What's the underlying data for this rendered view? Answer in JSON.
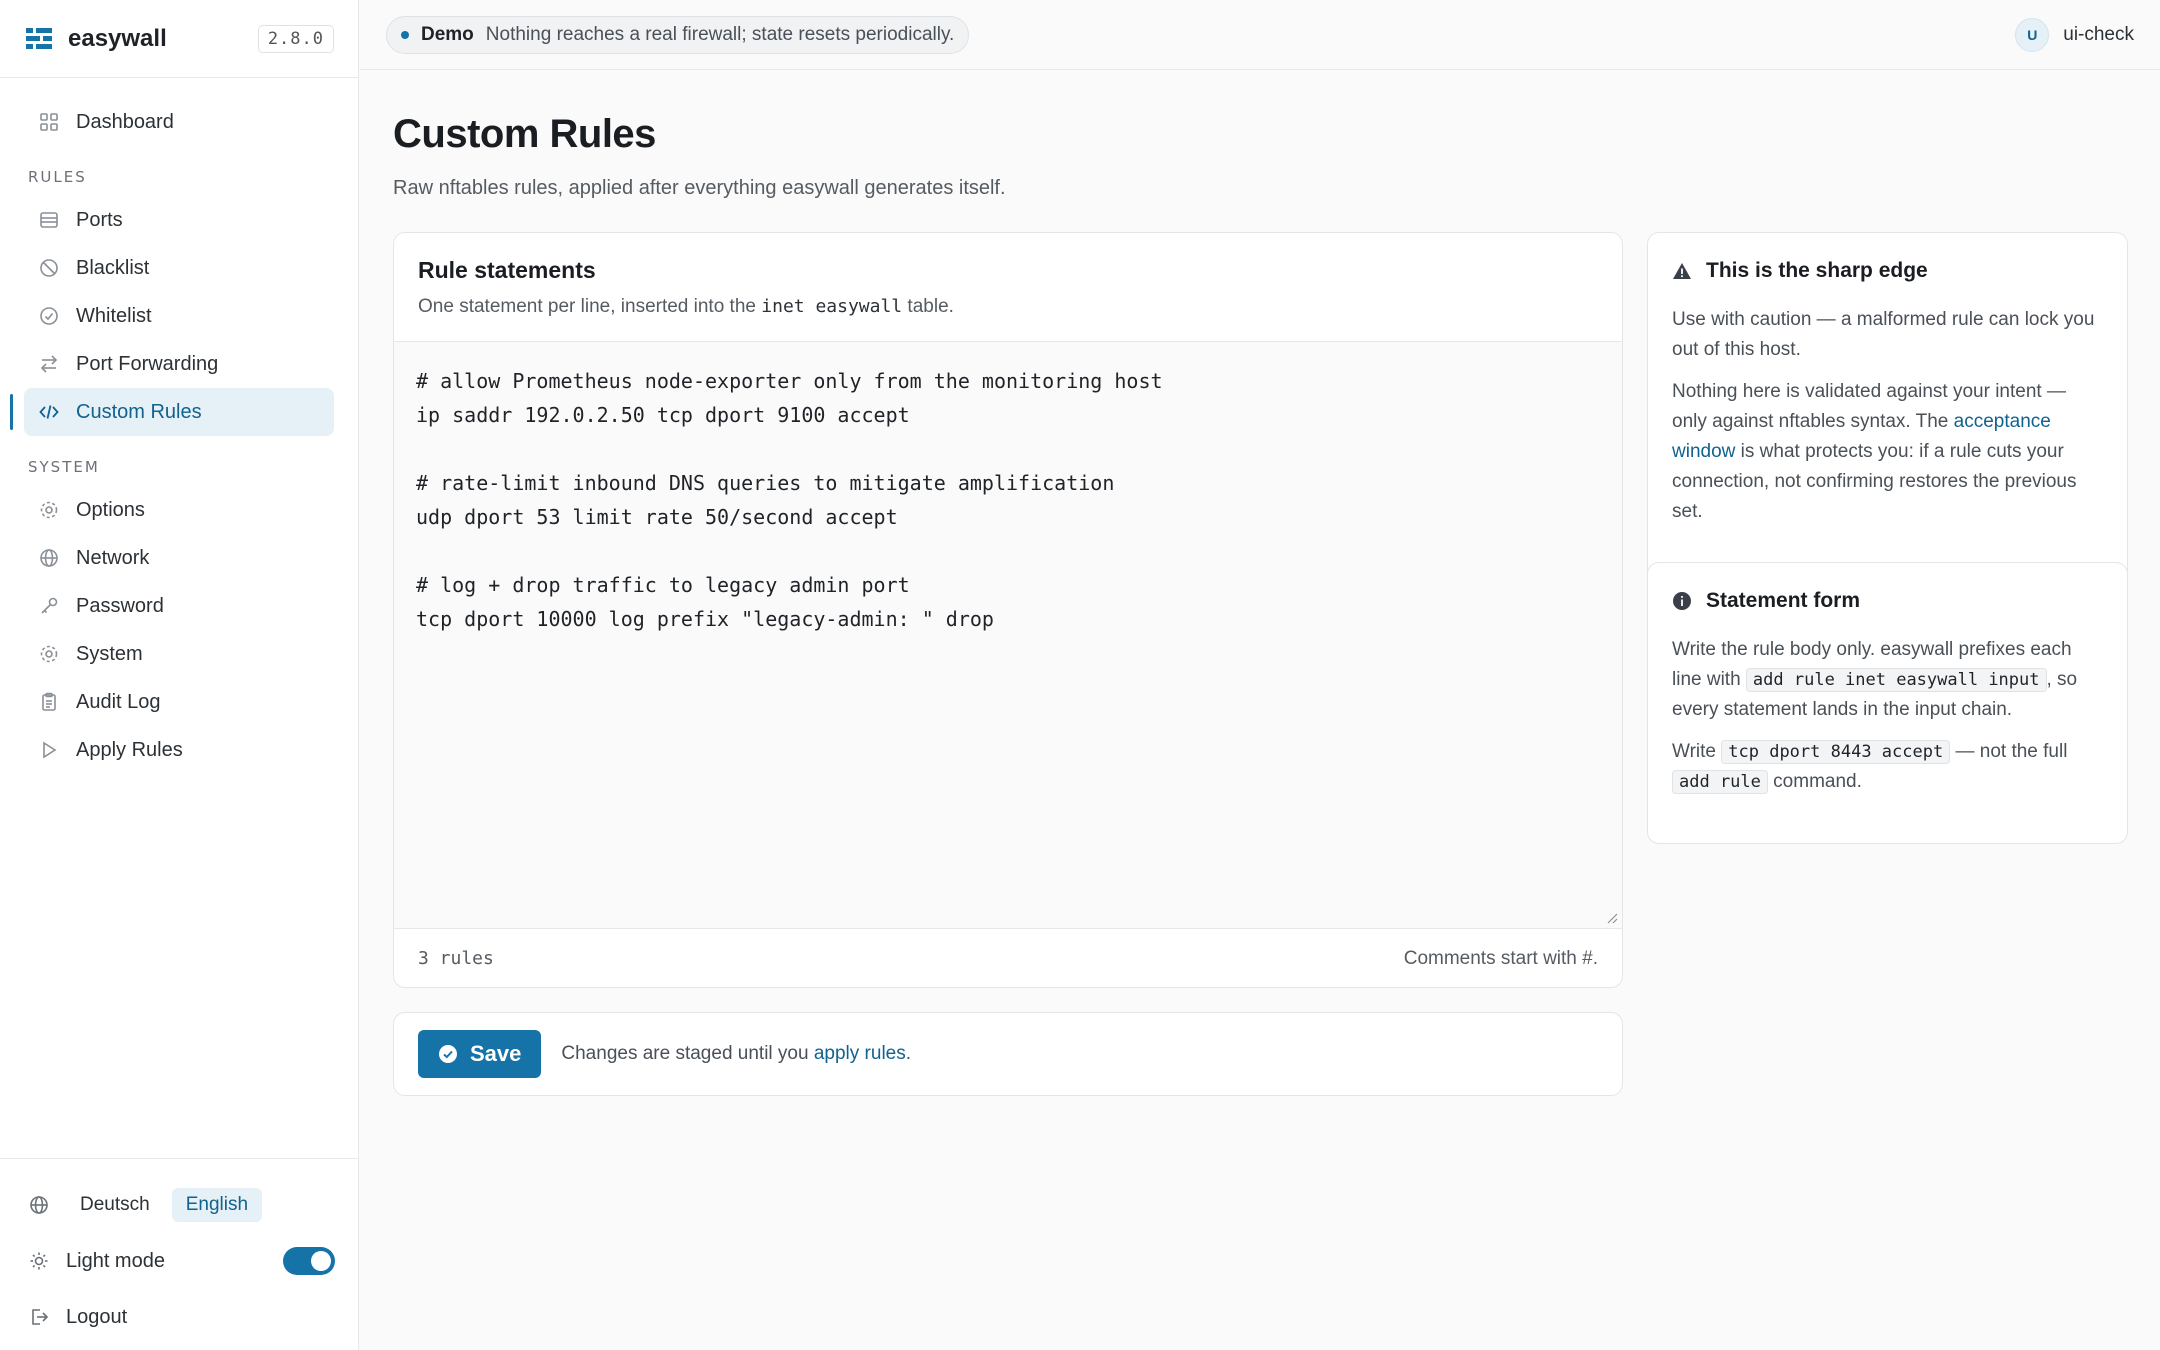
{
  "brand": {
    "name": "easywall",
    "version": "2.8.0"
  },
  "nav": {
    "dashboard": "Dashboard",
    "rules_label": "RULES",
    "rules": [
      "Ports",
      "Blacklist",
      "Whitelist",
      "Port Forwarding",
      "Custom Rules"
    ],
    "system_label": "SYSTEM",
    "system": [
      "Options",
      "Network",
      "Password",
      "System",
      "Audit Log",
      "Apply Rules"
    ],
    "active": "Custom Rules"
  },
  "bottom": {
    "lang_de": "Deutsch",
    "lang_en": "English",
    "mode_label": "Light mode",
    "logout": "Logout"
  },
  "topbar": {
    "demo_title": "Demo",
    "demo_text": "Nothing reaches a real firewall; state resets periodically.",
    "avatar_initial": "U",
    "username": "ui-check"
  },
  "page": {
    "title": "Custom Rules",
    "subtitle": "Raw nftables rules, applied after everything easywall generates itself."
  },
  "editor": {
    "title": "Rule statements",
    "desc_prefix": "One statement per line, inserted into the ",
    "desc_code": "inet easywall",
    "desc_suffix": " table.",
    "lines": [
      "# allow Prometheus node-exporter only from the monitoring host",
      "ip saddr 192.0.2.50 tcp dport 9100 accept",
      "",
      "# rate-limit inbound DNS queries to mitigate amplification",
      "udp dport 53 limit rate 50/second accept",
      "",
      "# log + drop traffic to legacy admin port",
      "tcp dport 10000 log prefix \"legacy-admin: \" drop"
    ],
    "count": "3 rules",
    "comments_hint": "Comments start with #."
  },
  "save": {
    "label": "Save",
    "note_prefix": "Changes are staged until you ",
    "note_link": "apply rules",
    "note_suffix": "."
  },
  "warning": {
    "title": "This is the sharp edge",
    "p1": "Use with caution — a malformed rule can lock you out of this host.",
    "p2_prefix": "Nothing here is validated against your intent — only against nftables syntax. The ",
    "p2_link": "acceptance window",
    "p2_suffix": " is what protects you: if a rule cuts your connection, not confirming restores the previous set."
  },
  "form": {
    "title": "Statement form",
    "p1_prefix": "Write the rule body only. easywall prefixes each line with ",
    "p1_code": "add rule inet easywall input",
    "p1_suffix": ", so every statement lands in the input chain.",
    "p2_prefix": "Write ",
    "p2_code1": "tcp dport 8443 accept",
    "p2_mid": " — not the full ",
    "p2_code2": "add rule",
    "p2_suffix": " command."
  },
  "colors": {
    "accent": "#1573a8",
    "accent_bg": "#e6f0f7"
  }
}
